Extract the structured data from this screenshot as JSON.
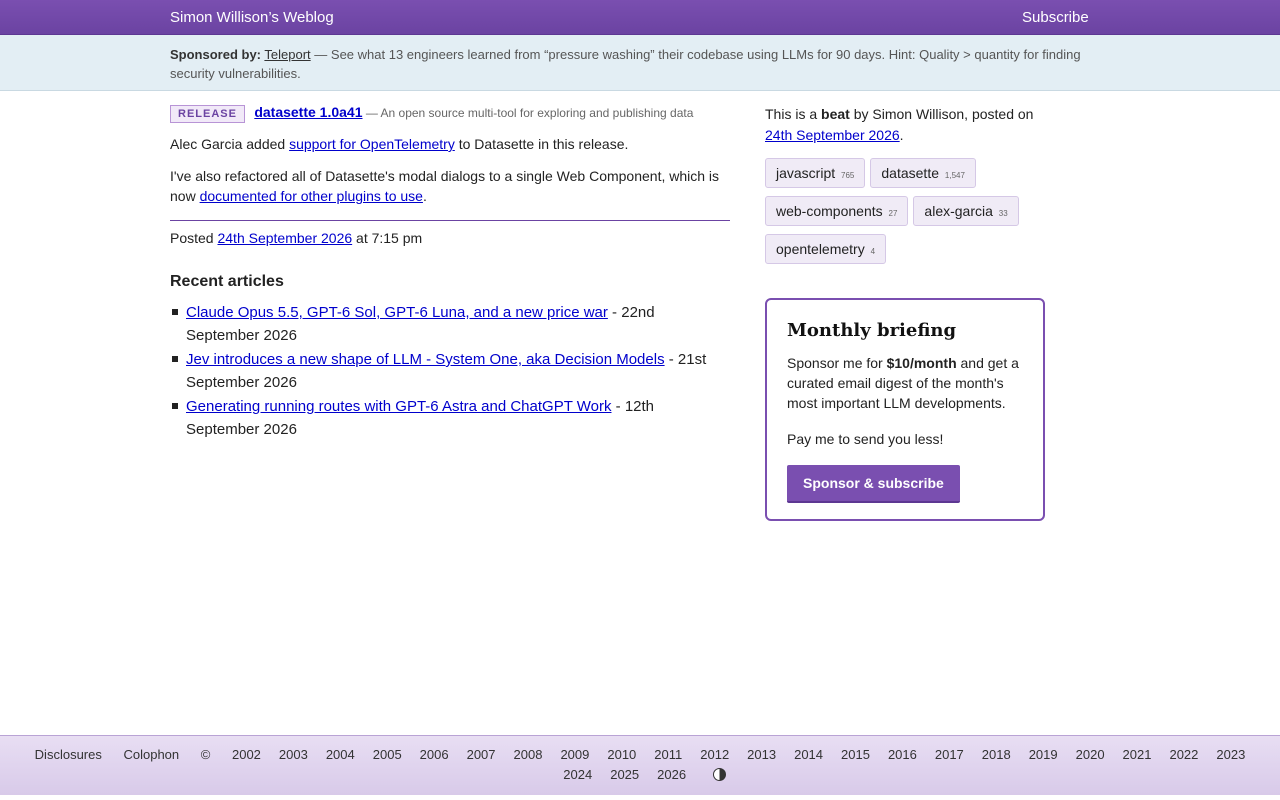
{
  "header": {
    "site_title": "Simon Willison’s Weblog",
    "subscribe_label": "Subscribe"
  },
  "sponsor": {
    "label": "Sponsored by:",
    "sponsor_name": "Teleport",
    "message": "— See what 13 engineers learned from “pressure washing” their codebase using LLMs for 90 days. Hint: Quality > quantity for finding security vulnerabilities."
  },
  "release": {
    "badge": "RELEASE",
    "name": "datasette 1.0a41",
    "description": "— An open source multi-tool for exploring and publishing data"
  },
  "post": {
    "p1_before": "Alec Garcia added ",
    "p1_link": "support for OpenTelemetry",
    "p1_after": " to Datasette in this release.",
    "p2_before": "I've also refactored all of Datasette's modal dialogs to a single Web Component, which is now ",
    "p2_link": "documented for other plugins to use",
    "p2_after": ".",
    "posted_label": "Posted ",
    "posted_date": "24th September 2026",
    "posted_time": " at 7:15 pm"
  },
  "recent": {
    "heading": "Recent articles",
    "items": [
      {
        "title": "Claude Opus 5.5, GPT-6 Sol, GPT-6 Luna, and a new price war",
        "date": " - 22nd September 2026"
      },
      {
        "title": "Jev introduces a new shape of LLM - System One, aka Decision Models",
        "date": " - 21st September 2026"
      },
      {
        "title": "Generating running routes with GPT-6 Astra and ChatGPT Work",
        "date": " - 12th September 2026"
      }
    ]
  },
  "sidebar": {
    "intro_before": "This is a ",
    "intro_bold": "beat",
    "intro_after": " by Simon Willison, posted on ",
    "intro_date": "24th September 2026",
    "intro_end": ".",
    "tags": [
      {
        "name": "javascript",
        "count": "765"
      },
      {
        "name": "datasette",
        "count": "1,547"
      },
      {
        "name": "web-components",
        "count": "27"
      },
      {
        "name": "alex-garcia",
        "count": "33"
      },
      {
        "name": "opentelemetry",
        "count": "4"
      }
    ]
  },
  "briefing": {
    "title": "Monthly briefing",
    "p1_before": "Sponsor me for ",
    "p1_bold": "$10/month",
    "p1_after": " and get a curated email digest of the month's most important LLM developments.",
    "p2": "Pay me to send you less!",
    "button": "Sponsor & subscribe"
  },
  "footer": {
    "disclosures": "Disclosures",
    "colophon": "Colophon",
    "copyright": "©",
    "years_row1": [
      "2002",
      "2003",
      "2004",
      "2005",
      "2006",
      "2007",
      "2008",
      "2009",
      "2010",
      "2011",
      "2012",
      "2013",
      "2014",
      "2015",
      "2016",
      "2017",
      "2018",
      "2019",
      "2020",
      "2021",
      "2022",
      "2023"
    ],
    "years_row2": [
      "2024",
      "2025",
      "2026"
    ]
  },
  "icons": {
    "theme_toggle": "contrast-icon"
  },
  "colors": {
    "accent": "#6b43a2",
    "link": "#0000cc",
    "sponsor_bg": "#e3eef4"
  }
}
